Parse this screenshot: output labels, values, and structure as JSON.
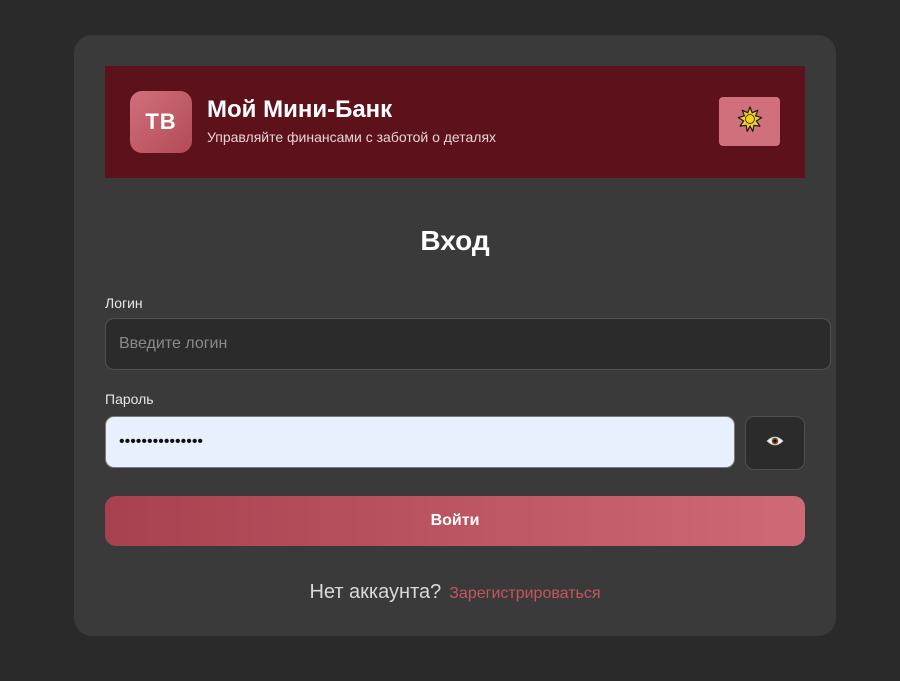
{
  "brand": {
    "logo_text": "ТВ",
    "title": "Мой Мини-Банк",
    "subtitle": "Управляйте финансами с заботой о деталях"
  },
  "theme_toggle": {
    "icon": "sun-icon"
  },
  "form": {
    "title": "Вход",
    "login_label": "Логин",
    "login_placeholder": "Введите логин",
    "login_value": "",
    "password_label": "Пароль",
    "password_value": "•••••••••••••••",
    "show_password_icon": "eye-icon",
    "submit_label": "Войти"
  },
  "footer": {
    "question": "Нет аккаунта?",
    "register_link": "Зарегистрироваться"
  },
  "colors": {
    "page_background": "#2a2a2a",
    "card_background": "#3a3a3a",
    "header_background": "#5c111b",
    "accent": "#d0707c",
    "link": "#c45562",
    "autofill_background": "#e8f0fe"
  }
}
